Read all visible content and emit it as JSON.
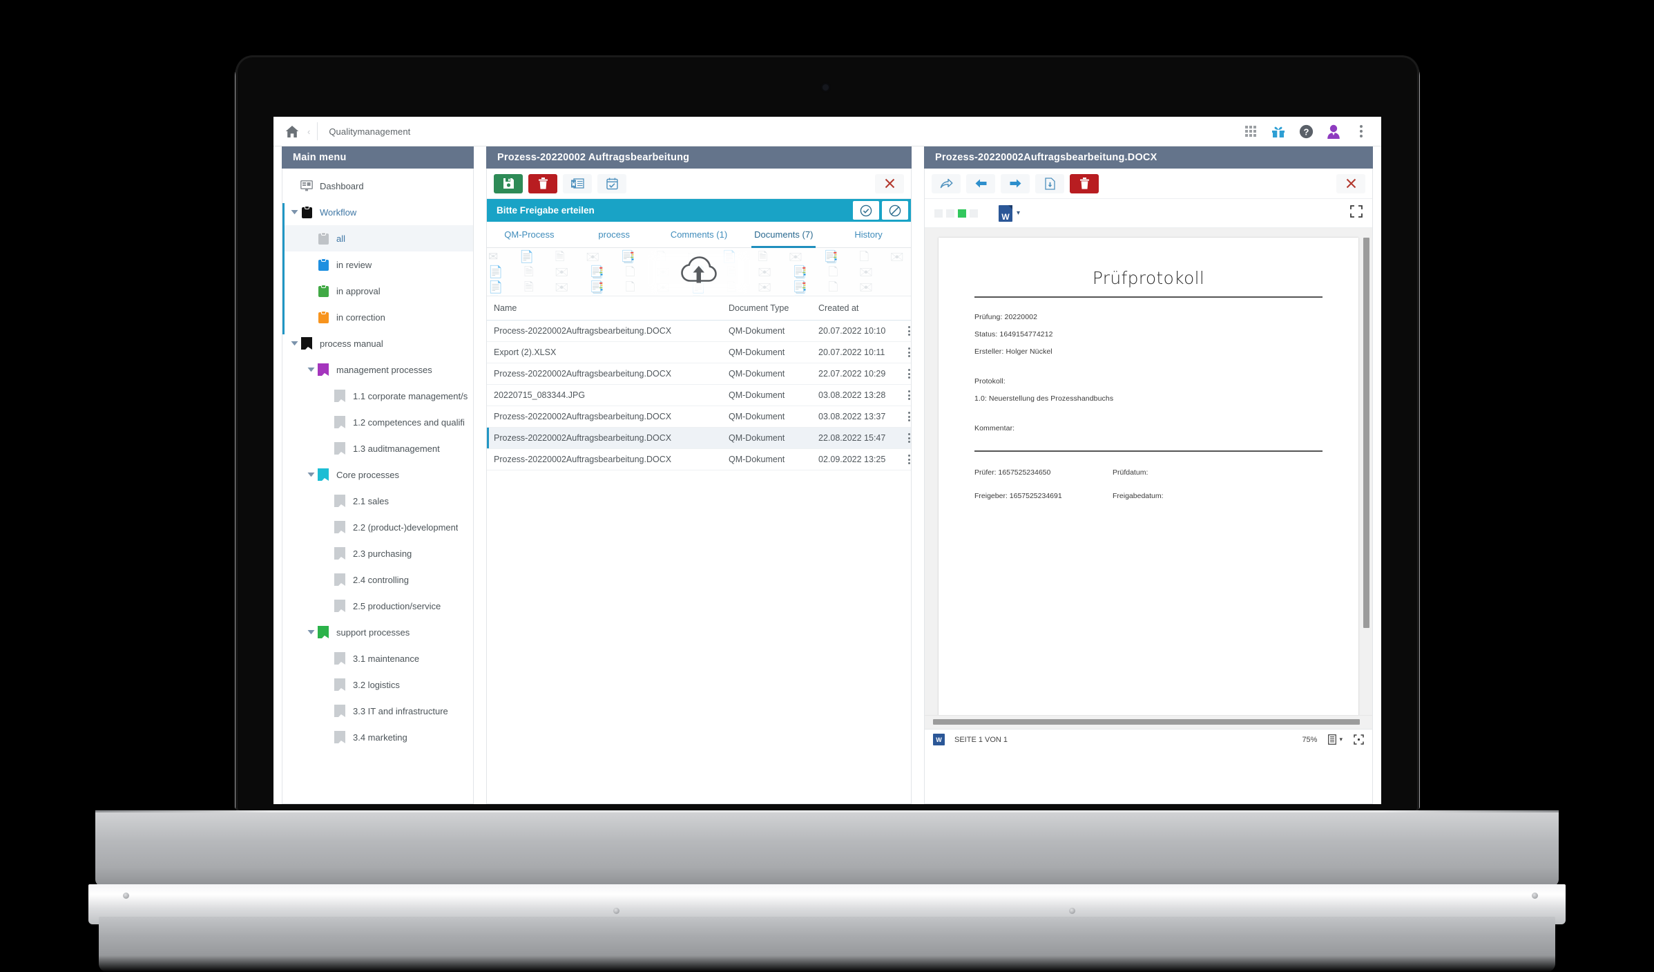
{
  "header": {
    "home_icon": "home-icon",
    "breadcrumb_separator": "‹",
    "title": "Qualitymanagement",
    "icons": [
      {
        "name": "app-grid-icon",
        "label": "apps"
      },
      {
        "name": "gift-icon",
        "label": "whats-new"
      },
      {
        "name": "help-icon",
        "label": "help"
      },
      {
        "name": "user-avatar-icon",
        "label": "account"
      },
      {
        "name": "overflow-menu-icon",
        "label": "more"
      }
    ]
  },
  "sidebar": {
    "title": "Main menu",
    "items": [
      {
        "label": "Dashboard",
        "icon": "dashboard-icon",
        "depth": 0,
        "caret": "none",
        "color": "#8b9096",
        "selected": false
      },
      {
        "label": "Workflow",
        "icon": "clipboard-icon",
        "depth": 0,
        "caret": "down",
        "color": "#111111",
        "selected": false,
        "link": true
      },
      {
        "label": "all",
        "icon": "clipboard-icon",
        "depth": 1,
        "caret": "none",
        "color": "#bfc3c7",
        "selected": true,
        "link": true
      },
      {
        "label": "in review",
        "icon": "clipboard-icon",
        "depth": 1,
        "caret": "none",
        "color": "#1e8fe0",
        "selected": false
      },
      {
        "label": "in approval",
        "icon": "clipboard-icon",
        "depth": 1,
        "caret": "none",
        "color": "#41a945",
        "selected": false
      },
      {
        "label": "in correction",
        "icon": "clipboard-icon",
        "depth": 1,
        "caret": "none",
        "color": "#f7941e",
        "selected": false
      },
      {
        "label": "process manual",
        "icon": "book-icon",
        "depth": 0,
        "caret": "down",
        "color": "#111111",
        "selected": false
      },
      {
        "label": "management processes",
        "icon": "book-icon",
        "depth": 1,
        "caret": "down",
        "color": "#a435bd",
        "selected": false
      },
      {
        "label": "1.1 corporate management/s",
        "icon": "book-icon",
        "depth": 2,
        "caret": "none",
        "color": "#c9cdd1",
        "selected": false
      },
      {
        "label": "1.2 competences and qualifi",
        "icon": "book-icon",
        "depth": 2,
        "caret": "none",
        "color": "#c9cdd1",
        "selected": false
      },
      {
        "label": "1.3 auditmanagement",
        "icon": "book-icon",
        "depth": 2,
        "caret": "none",
        "color": "#c9cdd1",
        "selected": false
      },
      {
        "label": "Core processes",
        "icon": "book-icon",
        "depth": 1,
        "caret": "down",
        "color": "#1cbdd4",
        "selected": false
      },
      {
        "label": "2.1 sales",
        "icon": "book-icon",
        "depth": 2,
        "caret": "none",
        "color": "#c9cdd1",
        "selected": false
      },
      {
        "label": "2.2 (product-)development",
        "icon": "book-icon",
        "depth": 2,
        "caret": "none",
        "color": "#c9cdd1",
        "selected": false
      },
      {
        "label": "2.3 purchasing",
        "icon": "book-icon",
        "depth": 2,
        "caret": "none",
        "color": "#c9cdd1",
        "selected": false
      },
      {
        "label": "2.4 controlling",
        "icon": "book-icon",
        "depth": 2,
        "caret": "none",
        "color": "#c9cdd1",
        "selected": false
      },
      {
        "label": "2.5 production/service",
        "icon": "book-icon",
        "depth": 2,
        "caret": "none",
        "color": "#c9cdd1",
        "selected": false
      },
      {
        "label": "support processes",
        "icon": "book-icon",
        "depth": 1,
        "caret": "down",
        "color": "#2bb34a",
        "selected": false
      },
      {
        "label": "3.1 maintenance",
        "icon": "book-icon",
        "depth": 2,
        "caret": "none",
        "color": "#c9cdd1",
        "selected": false
      },
      {
        "label": "3.2 logistics",
        "icon": "book-icon",
        "depth": 2,
        "caret": "none",
        "color": "#c9cdd1",
        "selected": false
      },
      {
        "label": "3.3 IT and infrastructure",
        "icon": "book-icon",
        "depth": 2,
        "caret": "none",
        "color": "#c9cdd1",
        "selected": false
      },
      {
        "label": "3.4 marketing",
        "icon": "book-icon",
        "depth": 2,
        "caret": "none",
        "color": "#c9cdd1",
        "selected": false
      }
    ]
  },
  "process_panel": {
    "title": "Prozess-20220002 Auftragsbearbeitung",
    "toolbar": [
      {
        "name": "save-button",
        "icon": "floppy-disk-icon",
        "style": "green"
      },
      {
        "name": "delete-button",
        "icon": "trash-icon",
        "style": "red"
      },
      {
        "name": "word-export-button",
        "icon": "word-document-icon",
        "style": "ghost"
      },
      {
        "name": "checklist-button",
        "icon": "calendar-check-icon",
        "style": "ghost"
      },
      {
        "name": "close-button",
        "icon": "close-x-icon",
        "style": "plainx"
      }
    ],
    "approval": {
      "message": "Bitte Freigabe erteilen",
      "approve_icon": "check-circle-icon",
      "reject_icon": "forbidden-circle-icon"
    },
    "tabs": [
      {
        "label": "QM-Process",
        "active": false
      },
      {
        "label": "process",
        "active": false
      },
      {
        "label": "Comments (1)",
        "active": false
      },
      {
        "label": "Documents (7)",
        "active": true
      },
      {
        "label": "History",
        "active": false
      }
    ],
    "dropzone": {
      "icon": "cloud-upload-icon"
    },
    "table": {
      "columns": [
        "Name",
        "Document Type",
        "Created at"
      ],
      "rows": [
        {
          "name": "Process-20220002Auftragsbearbeitung.DOCX",
          "type": "QM-Dokument",
          "created": "20.07.2022 10:10",
          "selected": false
        },
        {
          "name": "Export (2).XLSX",
          "type": "QM-Dokument",
          "created": "20.07.2022 10:11",
          "selected": false
        },
        {
          "name": "Prozess-20220002Auftragsbearbeitung.DOCX",
          "type": "QM-Dokument",
          "created": "22.07.2022 10:29",
          "selected": false
        },
        {
          "name": "20220715_083344.JPG",
          "type": "QM-Dokument",
          "created": "03.08.2022 13:28",
          "selected": false
        },
        {
          "name": "Prozess-20220002Auftragsbearbeitung.DOCX",
          "type": "QM-Dokument",
          "created": "03.08.2022 13:37",
          "selected": false
        },
        {
          "name": "Prozess-20220002Auftragsbearbeitung.DOCX",
          "type": "QM-Dokument",
          "created": "22.08.2022 15:47",
          "selected": true
        },
        {
          "name": "Prozess-20220002Auftragsbearbeitung.DOCX",
          "type": "QM-Dokument",
          "created": "02.09.2022 13:25",
          "selected": false
        }
      ]
    }
  },
  "viewer_panel": {
    "title": "Prozess-20220002Auftragsbearbeitung.DOCX",
    "toolbar": [
      {
        "name": "share-button",
        "icon": "share-arrow-icon",
        "style": "ghost"
      },
      {
        "name": "previous-button",
        "icon": "arrow-left-icon",
        "style": "ghost"
      },
      {
        "name": "next-button",
        "icon": "arrow-right-icon",
        "style": "ghost"
      },
      {
        "name": "download-button",
        "icon": "file-download-icon",
        "style": "ghost"
      },
      {
        "name": "delete-button",
        "icon": "trash-icon",
        "style": "red"
      },
      {
        "name": "close-button",
        "icon": "close-x-icon",
        "style": "plainx"
      }
    ],
    "swatches": [
      "#eef0f2",
      "#eef0f2",
      "#32c75d",
      "#eef0f2"
    ],
    "file_type_glyph": "W",
    "file_type_caret": "▾",
    "expand_icon": "fullscreen-icon",
    "document": {
      "title": "Prüfprotokoll",
      "fields": [
        "Prüfung: 20220002",
        "Status: 1649154774212",
        "Ersteller: Holger Nückel"
      ],
      "protocol_label": "Protokoll:",
      "protocol_entry": "1.0: Neuerstellung des Prozesshandbuchs",
      "comment_label": "Kommentar:",
      "signatures": [
        {
          "left": "Prüfer: 1657525234650",
          "right": "Prüfdatum:"
        },
        {
          "left": "Freigeber: 1657525234691",
          "right": "Freigabedatum:"
        }
      ]
    },
    "status_bar": {
      "glyph": "W",
      "page_text": "SEITE 1 VON 1",
      "zoom": "75%",
      "layout_icon": "page-layout-icon",
      "layout_caret": "▾",
      "fit_icon": "fit-page-icon"
    }
  }
}
